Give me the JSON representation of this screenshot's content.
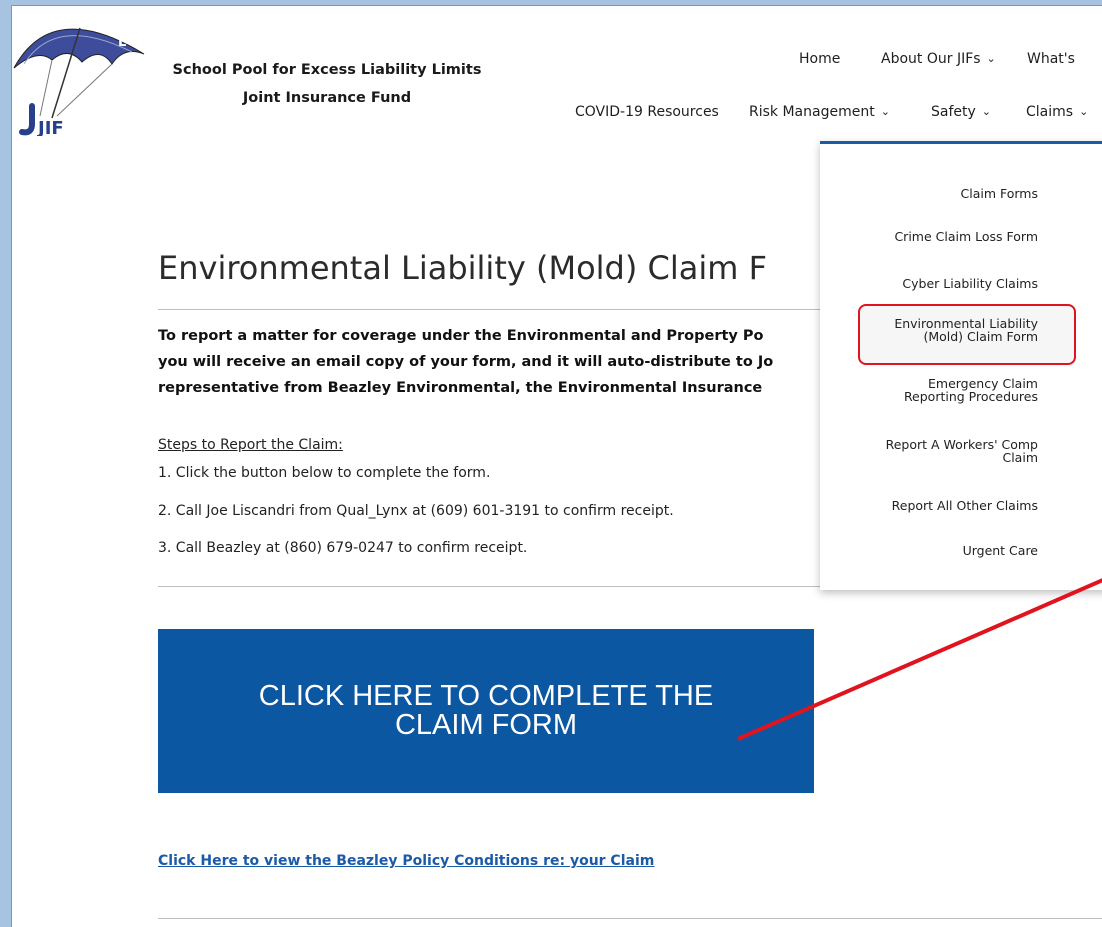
{
  "header": {
    "logo": {
      "letters": [
        "S",
        "P",
        "E",
        "L",
        "L"
      ],
      "jif": "JIF"
    },
    "org_line1": "School Pool for Excess Liability Limits",
    "org_line2": "Joint Insurance Fund"
  },
  "nav": {
    "row1": [
      {
        "label": "Home"
      },
      {
        "label": "About Our JIFs",
        "chevron": true
      },
      {
        "label": "What's"
      }
    ],
    "row2": [
      {
        "label": "COVID-19 Resources"
      },
      {
        "label": "Risk Management",
        "chevron": true
      },
      {
        "label": "Safety",
        "chevron": true
      },
      {
        "label": "Claims",
        "chevron": true
      }
    ]
  },
  "dropdown": {
    "items": [
      {
        "label": "Claim Forms"
      },
      {
        "label": "Crime Claim Loss Form"
      },
      {
        "label": "Cyber Liability Claims"
      },
      {
        "label": "Environmental Liability\n(Mold) Claim Form",
        "highlighted": true
      },
      {
        "label": "Emergency Claim\nReporting Procedures"
      },
      {
        "label": "Report A Workers' Comp\nClaim"
      },
      {
        "label": "Report All Other Claims"
      },
      {
        "label": "Urgent Care"
      }
    ]
  },
  "main": {
    "title": "Environmental Liability (Mold) Claim F",
    "intro_lines": [
      "To report a matter for coverage under the Environmental and Property Po",
      "you will receive an email copy of your form, and it will auto-distribute to Jo",
      "representative from Beazley Environmental, the Environmental Insurance"
    ],
    "steps_title": "Steps to Report the Claim:",
    "steps": [
      "1. Click the button below to complete the form.",
      "2. Call Joe Liscandri from Qual_Lynx at (609) 601-3191 to confirm receipt.",
      "3. Call Beazley at (860) 679-0247 to confirm receipt."
    ],
    "cta_label": "CLICK HERE TO COMPLETE THE CLAIM FORM",
    "policy_link": "Click Here to view the Beazley Policy Conditions re: your Claim"
  },
  "colors": {
    "accent": "#0c57a2",
    "annotation": "#e0141e",
    "frame": "#a7c3e2"
  }
}
